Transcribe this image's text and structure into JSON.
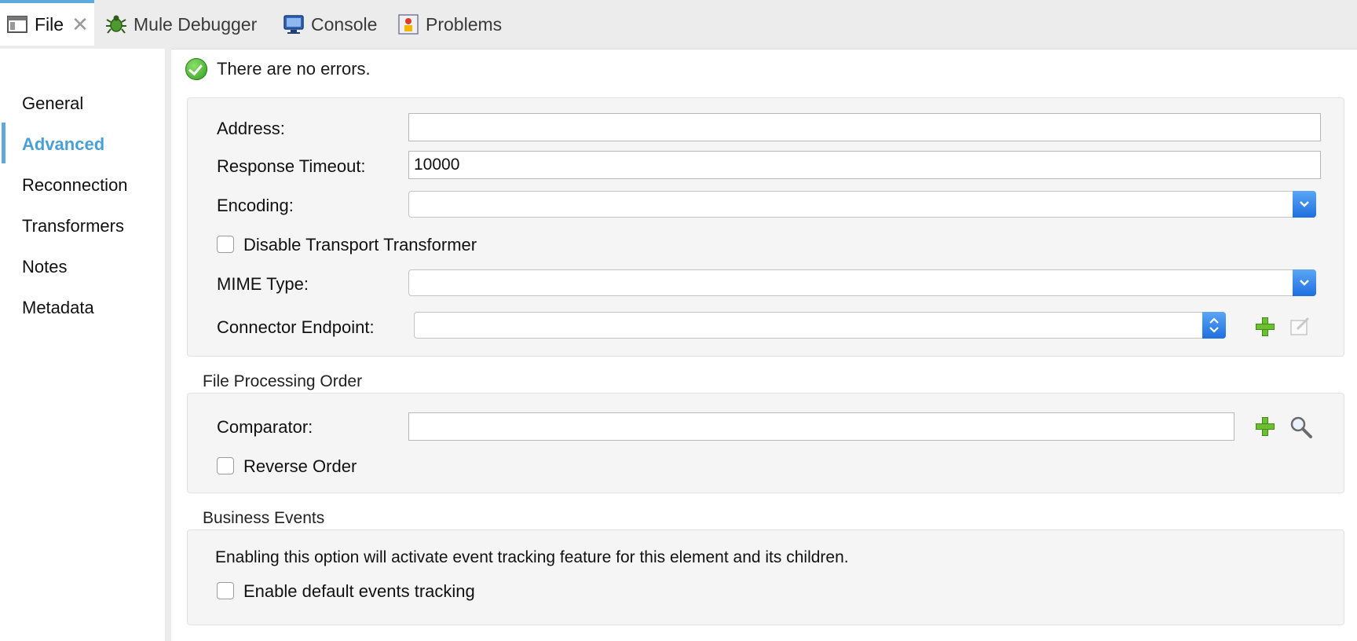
{
  "tabs": [
    {
      "label": "File",
      "icon": "file-icon",
      "active": true
    },
    {
      "label": "Mule Debugger",
      "icon": "bug-icon"
    },
    {
      "label": "Console",
      "icon": "monitor-icon"
    },
    {
      "label": "Problems",
      "icon": "problems-icon"
    }
  ],
  "nav": {
    "items": [
      "General",
      "Advanced",
      "Reconnection",
      "Transformers",
      "Notes",
      "Metadata"
    ],
    "active": "Advanced"
  },
  "status": {
    "text": "There are no errors."
  },
  "general": {
    "address_label": "Address:",
    "address_value": "",
    "timeout_label": "Response Timeout:",
    "timeout_value": "10000",
    "encoding_label": "Encoding:",
    "disable_transformer_label": "Disable Transport Transformer",
    "mime_label": "MIME Type:",
    "connector_label": "Connector Endpoint:"
  },
  "processing": {
    "title": "File Processing Order",
    "comparator_label": "Comparator:",
    "comparator_value": "",
    "reverse_label": "Reverse Order"
  },
  "business": {
    "title": "Business Events",
    "description": "Enabling this option will activate event tracking feature for this element and its children.",
    "tracking_label": "Enable default events tracking"
  },
  "colors": {
    "accent": "#4a9fd5",
    "panel": "#f5f5f5",
    "tabbar": "#ececec"
  }
}
